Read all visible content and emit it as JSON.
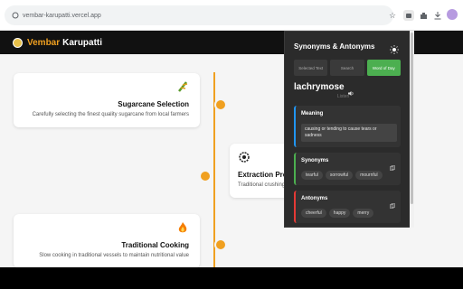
{
  "browser": {
    "url": "vembar-karupatti.vercel.app"
  },
  "site": {
    "brand_first": "Vembar",
    "brand_second": "Karupatti",
    "accent": "#f0a020",
    "cards": [
      {
        "title": "Sugarcane Selection",
        "desc": "Carefully selecting the finest quality sugarcane from local farmers",
        "icon": "sugarcane-icon"
      },
      {
        "title": "Extraction Pro",
        "desc": "Traditional crushing",
        "icon": "gear-icon"
      },
      {
        "title": "Traditional Cooking",
        "desc": "Slow cooking in traditional vessels to maintain nutritional value",
        "icon": "fire-icon"
      }
    ]
  },
  "popup": {
    "title": "Synonyms & Antonyms",
    "tabs": [
      "Selected Text",
      "Search",
      "Word of Day"
    ],
    "active_tab": "Word of Day",
    "word": "lachrymose",
    "pronunciation": "Listen",
    "meaning_title": "Meaning",
    "meaning": "causing or tending to cause tears or sadness",
    "synonyms_title": "Synonyms",
    "synonyms": [
      "tearful",
      "sorrowful",
      "mournful"
    ],
    "antonyms_title": "Antonyms",
    "antonyms": [
      "cheerful",
      "happy",
      "merry"
    ],
    "colors": {
      "meaning": "#2196f3",
      "synonyms": "#4caf50",
      "antonyms": "#e53935",
      "active_tab": "#4caf50"
    }
  }
}
